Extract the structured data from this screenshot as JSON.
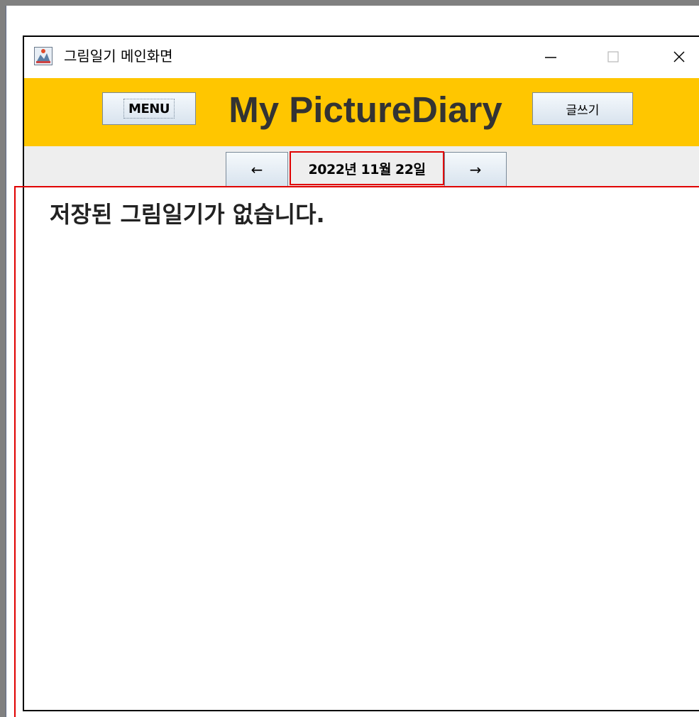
{
  "window": {
    "title": "그림일기 메인화면",
    "icons": {
      "app": "java-app-icon",
      "minimize": "minimize-icon",
      "maximize": "maximize-icon",
      "close": "close-icon"
    }
  },
  "header": {
    "menu_label": "MENU",
    "app_title": "My PictureDiary",
    "write_label": "글쓰기",
    "background_color": "#ffc600"
  },
  "nav": {
    "prev_label": "←",
    "next_label": "→",
    "date_text": "2022년 11월 22일"
  },
  "content": {
    "empty_message": "저장된 그림일기가 없습니다."
  },
  "colors": {
    "highlight_border": "#e00000",
    "header_bg": "#ffc600",
    "nav_bg": "#eeeeee"
  }
}
